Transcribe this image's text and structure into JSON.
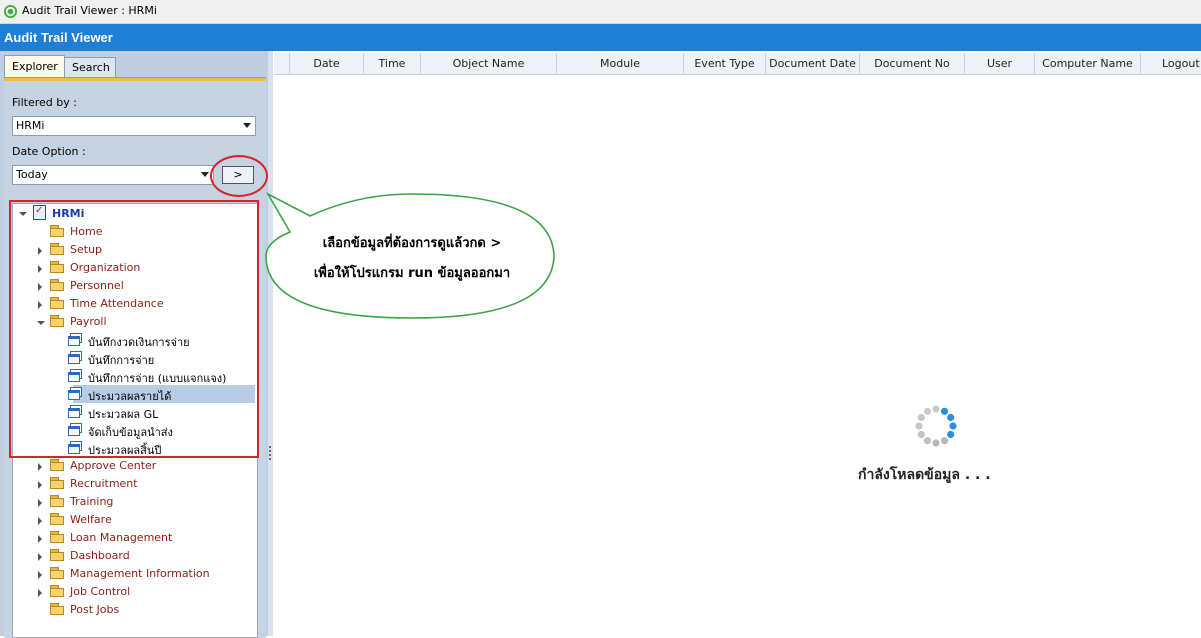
{
  "window": {
    "title": "Audit Trail Viewer : HRMi",
    "header_title": "Audit Trail Viewer"
  },
  "tabs": [
    {
      "label": "Explorer",
      "active": true
    },
    {
      "label": "Search",
      "active": false
    }
  ],
  "filter": {
    "label": "Filtered by :",
    "value": "HRMi"
  },
  "date_option": {
    "label": "Date Option :",
    "value": "Today",
    "go_label": ">"
  },
  "tree": {
    "root": "HRMi",
    "items": [
      {
        "label": "Home",
        "expander": "none"
      },
      {
        "label": "Setup",
        "expander": "closed"
      },
      {
        "label": "Organization",
        "expander": "closed"
      },
      {
        "label": "Personnel",
        "expander": "closed"
      },
      {
        "label": "Time Attendance",
        "expander": "closed"
      },
      {
        "label": "Payroll",
        "expander": "open"
      }
    ],
    "payroll_children": [
      "บันทึกงวดเงินการจ่าย",
      "บันทึกการจ่าย",
      "บันทึกการจ่าย (แบบแจกแจง)",
      "ประมวลผลรายได้",
      "ประมวลผล GL",
      "จัดเก็บข้อมูลนำส่ง",
      "ประมวลผลสิ้นปี"
    ],
    "selected_child": 3,
    "more_items": [
      {
        "label": "Approve Center",
        "expander": "closed"
      },
      {
        "label": "Recruitment",
        "expander": "closed"
      },
      {
        "label": "Training",
        "expander": "closed"
      },
      {
        "label": "Welfare",
        "expander": "closed"
      },
      {
        "label": "Loan Management",
        "expander": "closed"
      },
      {
        "label": "Dashboard",
        "expander": "closed"
      },
      {
        "label": "Management Information",
        "expander": "closed"
      },
      {
        "label": "Job Control",
        "expander": "closed"
      },
      {
        "label": "Post Jobs",
        "expander": "none"
      }
    ]
  },
  "grid": {
    "columns": [
      "Date",
      "Time",
      "Object Name",
      "Module",
      "Event Type",
      "Document Date",
      "Document No",
      "User",
      "Computer Name",
      "Logout T"
    ],
    "loading_text": "กำลังโหลดข้อมูล . . ."
  },
  "callout": {
    "line1": "เลือกข้อมูลที่ต้องการดูแล้วกด >",
    "line2": "เพื่อให้โปรแกรม run ข้อมูลออกมา"
  },
  "colors": {
    "header": "#1e7fd6",
    "annotation_red": "#d8232a",
    "callout_green": "#3aa543",
    "spinner": "#2a8fe0"
  }
}
